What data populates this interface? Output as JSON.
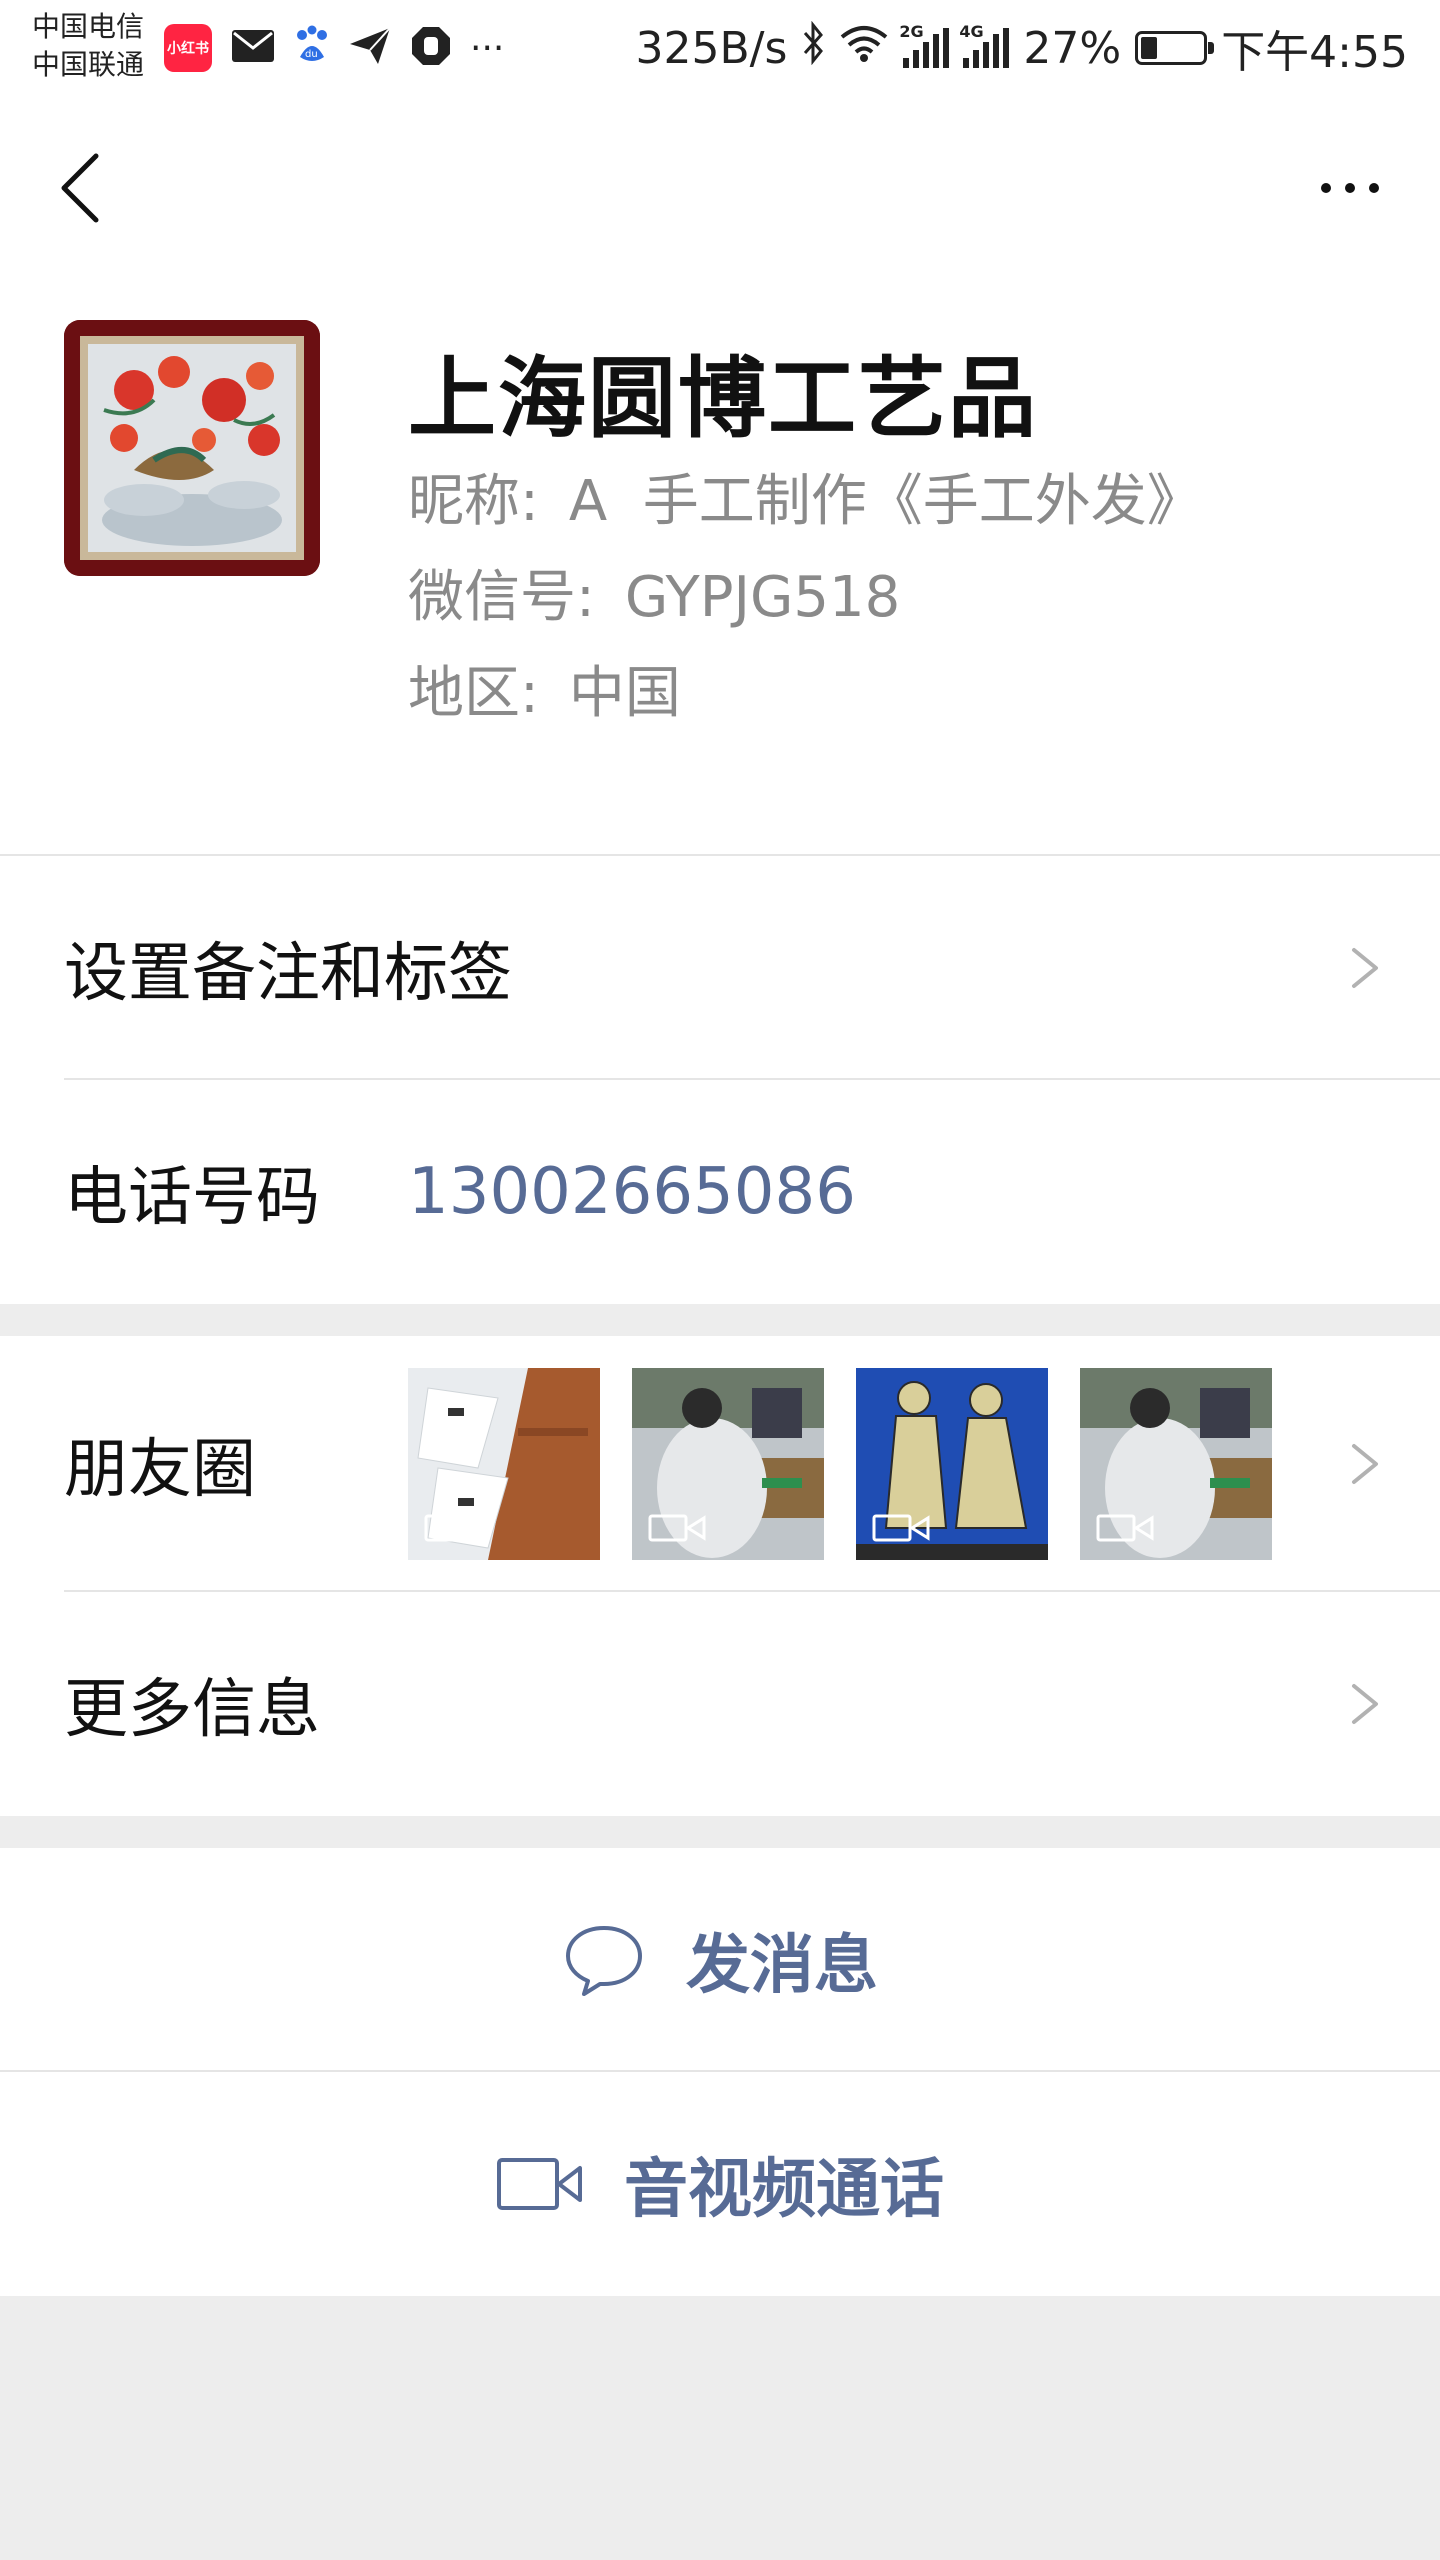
{
  "status_bar": {
    "carrier_1": "中国电信",
    "carrier_2": "中国联通",
    "app_badge": "小红书",
    "more_dots": "···",
    "net_speed": "325B/s",
    "sig1_tag": "2G",
    "sig2_tag": "4G",
    "battery_pct": "27%",
    "battery_level": 0.27,
    "time": "下午4:55",
    "icons": [
      "xiaohongshu-app-icon",
      "mail-icon",
      "baidu-icon",
      "send-icon",
      "hand-stop-icon",
      "bluetooth-icon",
      "wifi-icon",
      "signal-icon",
      "battery-icon"
    ]
  },
  "nav": {
    "back_icon": "chevron-left-icon",
    "more_icon": "more-horizontal-icon"
  },
  "profile": {
    "name": "上海圆博工艺品",
    "nickname_label": "昵称:",
    "nickname": "A  手工制作《手工外发》",
    "wechat_id_label": "微信号:",
    "wechat_id": "GYPJG518",
    "region_label": "地区:",
    "region": "中国"
  },
  "cells": {
    "remarks_tags": "设置备注和标签",
    "phone_label": "电话号码",
    "phone_value": "13002665086",
    "moments_label": "朋友圈",
    "more_info": "更多信息"
  },
  "actions": {
    "send_message": "发消息",
    "av_call": "音视频通话"
  },
  "colors": {
    "link": "#576b95",
    "background": "#ededed",
    "card": "#ffffff"
  }
}
